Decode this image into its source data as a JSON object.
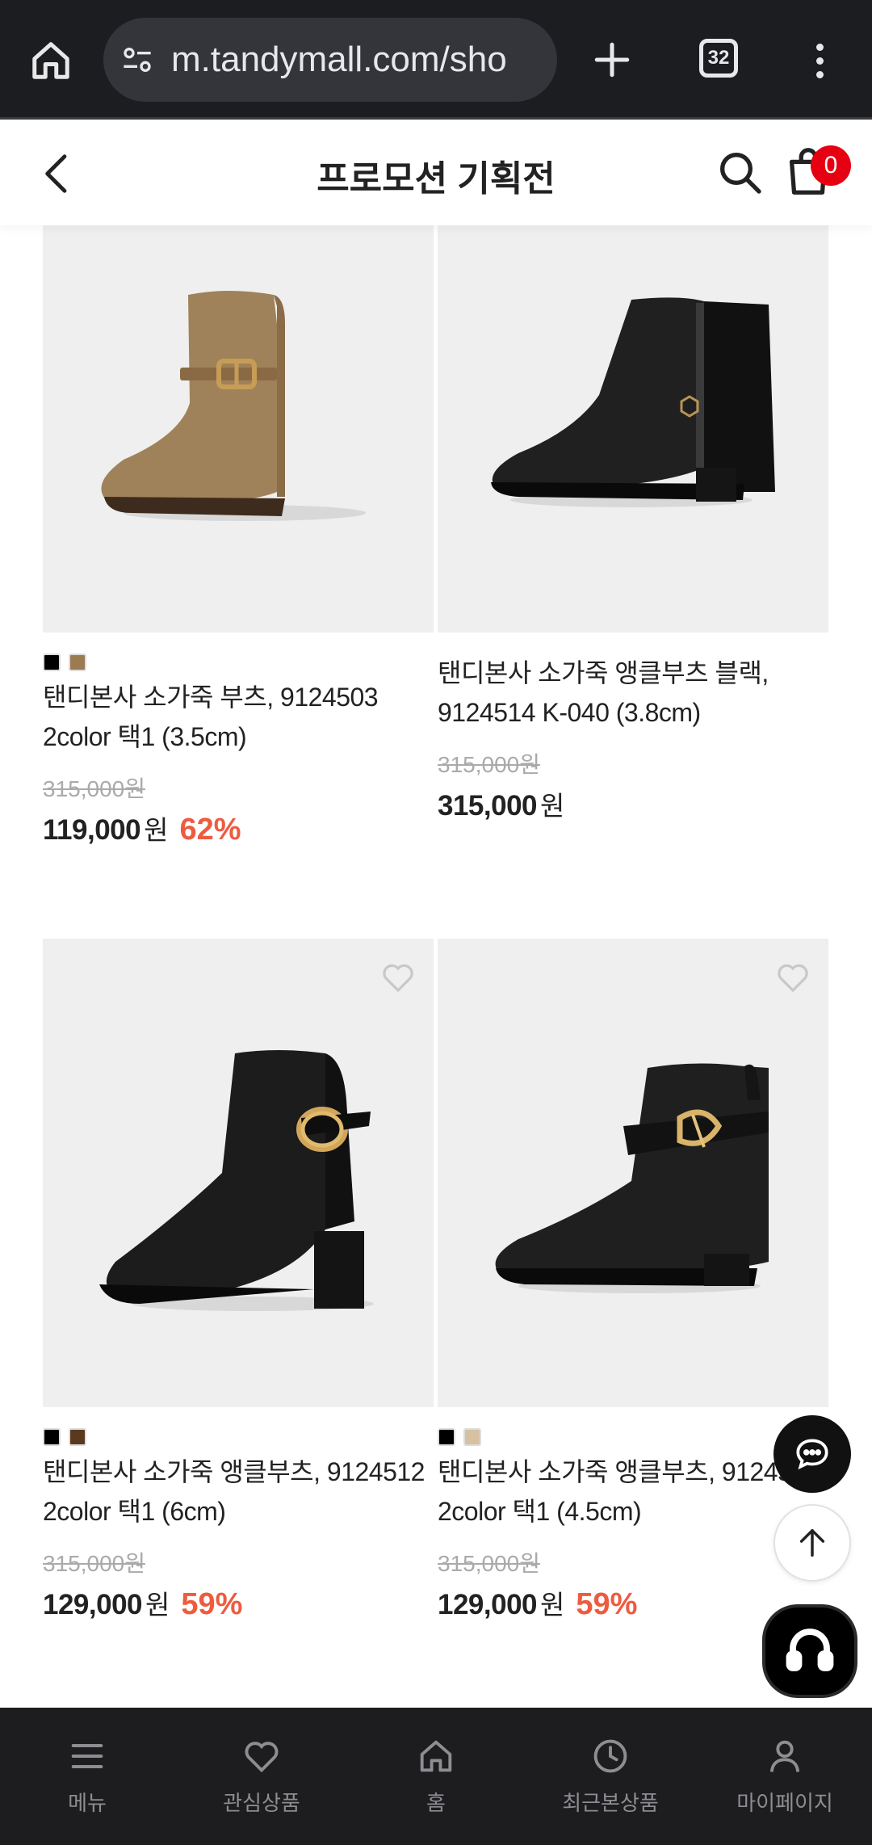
{
  "browser": {
    "url": "m.tandymall.com/sho",
    "tab_count": "32"
  },
  "header": {
    "title": "프로모션 기획전",
    "cart_count": "0"
  },
  "products": [
    {
      "name": "탠디본사 소가죽 부츠, 9124503 2color 택1 (3.5cm)",
      "original_price": "315,000원",
      "price": "119,000",
      "currency": "원",
      "discount": "62%",
      "swatches": [
        "#000000",
        "#9c7b52"
      ]
    },
    {
      "name": "탠디본사 소가죽 앵클부츠 블랙, 9124514 K-040 (3.8cm)",
      "original_price": "315,000원",
      "price": "315,000",
      "currency": "원",
      "discount": "",
      "swatches": []
    },
    {
      "name": "탠디본사 소가죽 앵클부츠, 9124512 2color 택1 (6cm)",
      "original_price": "315,000원",
      "price": "129,000",
      "currency": "원",
      "discount": "59%",
      "swatches": [
        "#000000",
        "#5a3a1e"
      ]
    },
    {
      "name": "탠디본사 소가죽 앵클부츠, 9124511 2color 택1 (4.5cm)",
      "original_price": "315,000원",
      "price": "129,000",
      "currency": "원",
      "discount": "59%",
      "swatches": [
        "#000000",
        "#d6c1a2"
      ]
    }
  ],
  "bottom_nav": [
    {
      "label": "메뉴",
      "icon": "menu-icon"
    },
    {
      "label": "관심상품",
      "icon": "heart-icon"
    },
    {
      "label": "홈",
      "icon": "home-icon"
    },
    {
      "label": "최근본상품",
      "icon": "clock-icon"
    },
    {
      "label": "마이페이지",
      "icon": "user-icon"
    }
  ],
  "colors": {
    "discount": "#ee5b3f",
    "badge": "#e60012",
    "nav_bg": "#1d1d1f",
    "browser_bg": "#1c1d20"
  }
}
